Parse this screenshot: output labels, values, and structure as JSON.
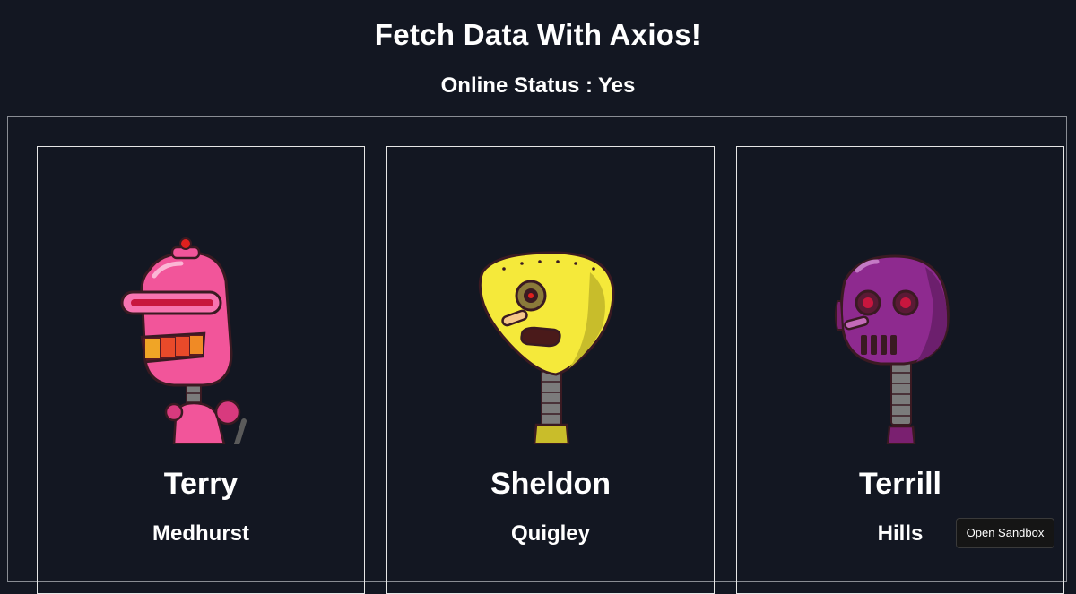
{
  "title": "Fetch Data With Axios!",
  "status": {
    "label": "Online Status :",
    "value": "Yes"
  },
  "users": [
    {
      "first_name": "Terry",
      "last_name": "Medhurst",
      "avatar_icon": "pink-robot-icon",
      "color": "#f2559a"
    },
    {
      "first_name": "Sheldon",
      "last_name": "Quigley",
      "avatar_icon": "yellow-robot-icon",
      "color": "#f5e93a"
    },
    {
      "first_name": "Terrill",
      "last_name": "Hills",
      "avatar_icon": "purple-robot-icon",
      "color": "#8e2a8f"
    }
  ],
  "sandbox_button": {
    "label": "Open Sandbox"
  },
  "colors": {
    "background": "#131722",
    "text": "#ffffff",
    "border": "#e6e6e6"
  }
}
